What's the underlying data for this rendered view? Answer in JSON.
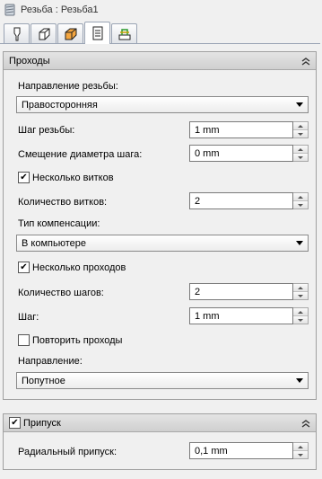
{
  "window": {
    "title": "Резьба : Резьба1"
  },
  "tabs": [
    {
      "icon": "tool-icon",
      "active": false
    },
    {
      "icon": "cube-outline-icon",
      "active": false
    },
    {
      "icon": "orange-block-icon",
      "active": false
    },
    {
      "icon": "operation-parameters-icon",
      "active": true
    },
    {
      "icon": "linking-icon",
      "active": false
    }
  ],
  "passes": {
    "title": "Проходы",
    "thread_direction_label": "Направление резьбы:",
    "thread_direction_value": "Правосторонняя",
    "pitch_label": "Шаг резьбы:",
    "pitch_value": "1 mm",
    "pitch_offset_label": "Смещение диаметра шага:",
    "pitch_offset_value": "0 mm",
    "multiple_starts_label": "Несколько витков",
    "multiple_starts_checked": true,
    "starts_count_label": "Количество витков:",
    "starts_count_value": "2",
    "compensation_label": "Тип компенсации:",
    "compensation_value": "В компьютере",
    "multiple_passes_label": "Несколько проходов",
    "multiple_passes_checked": true,
    "steps_count_label": "Количество шагов:",
    "steps_count_value": "2",
    "step_label": "Шаг:",
    "step_value": "1 mm",
    "repeat_passes_label": "Повторить проходы",
    "repeat_passes_checked": false,
    "direction_label": "Направление:",
    "direction_value": "Попутное"
  },
  "stock": {
    "title": "Припуск",
    "enabled": true,
    "radial_label": "Радиальный припуск:",
    "radial_value": "0,1 mm"
  }
}
